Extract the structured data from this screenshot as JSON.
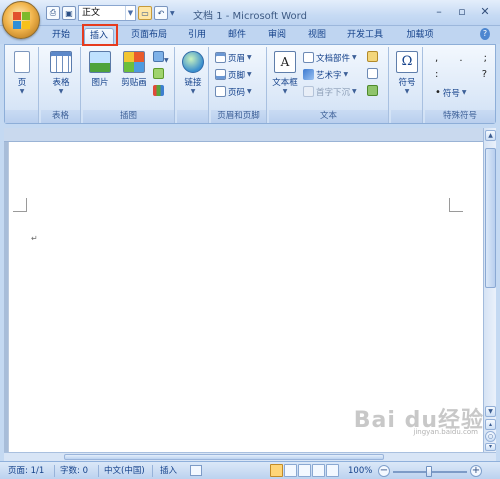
{
  "window": {
    "title": "文档 1 - Microsoft Word",
    "style_value": "正文",
    "controls": [
      "minimize-icon",
      "maximize-icon",
      "close-icon"
    ]
  },
  "quick_access": {
    "icons": [
      "print-icon",
      "save-icon",
      "open-folder-icon",
      "undo-icon"
    ]
  },
  "tabs": [
    {
      "label": "开始"
    },
    {
      "label": "插入",
      "active": true
    },
    {
      "label": "页面布局"
    },
    {
      "label": "引用"
    },
    {
      "label": "邮件"
    },
    {
      "label": "审阅"
    },
    {
      "label": "视图"
    },
    {
      "label": "开发工具"
    },
    {
      "label": "加载项"
    }
  ],
  "ribbon": {
    "groups": [
      {
        "name": "pages",
        "label": "",
        "buttons": [
          {
            "label": "页"
          }
        ]
      },
      {
        "name": "tables",
        "label": "表格",
        "buttons": [
          {
            "label": "表格"
          }
        ]
      },
      {
        "name": "illustrations",
        "label": "插图",
        "buttons": [
          {
            "label": "图片"
          },
          {
            "label": "剪贴画"
          }
        ]
      },
      {
        "name": "links",
        "label": "",
        "buttons": [
          {
            "label": "链接"
          }
        ]
      },
      {
        "name": "header-footer",
        "label": "页眉和页脚",
        "buttons": [
          {
            "label": "页眉"
          },
          {
            "label": "页脚"
          },
          {
            "label": "页码"
          }
        ]
      },
      {
        "name": "text",
        "label": "文本",
        "buttons": [
          {
            "label": "文本框"
          },
          {
            "label": "文档部件"
          },
          {
            "label": "艺术字"
          },
          {
            "label": "首字下沉"
          }
        ]
      },
      {
        "name": "symbols",
        "label": "",
        "buttons": [
          {
            "label": "符号"
          }
        ]
      },
      {
        "name": "special-symbols",
        "label": "特殊符号",
        "buttons": [
          {
            "label": "符号"
          }
        ],
        "marks": [
          ",",
          ".",
          ";",
          ":",
          "?"
        ]
      }
    ]
  },
  "status_bar": {
    "page": "页面: 1/1",
    "words": "字数: 0",
    "language": "中文(中国)",
    "mode": "插入",
    "zoom": "100%"
  },
  "watermark": {
    "text": "Bai du经验",
    "sub": "jingyan.baidu.com"
  },
  "colors": {
    "highlight": "#e63b1f",
    "ribbon_text": "#15428b",
    "ribbon_bg": "#dde9f8"
  }
}
